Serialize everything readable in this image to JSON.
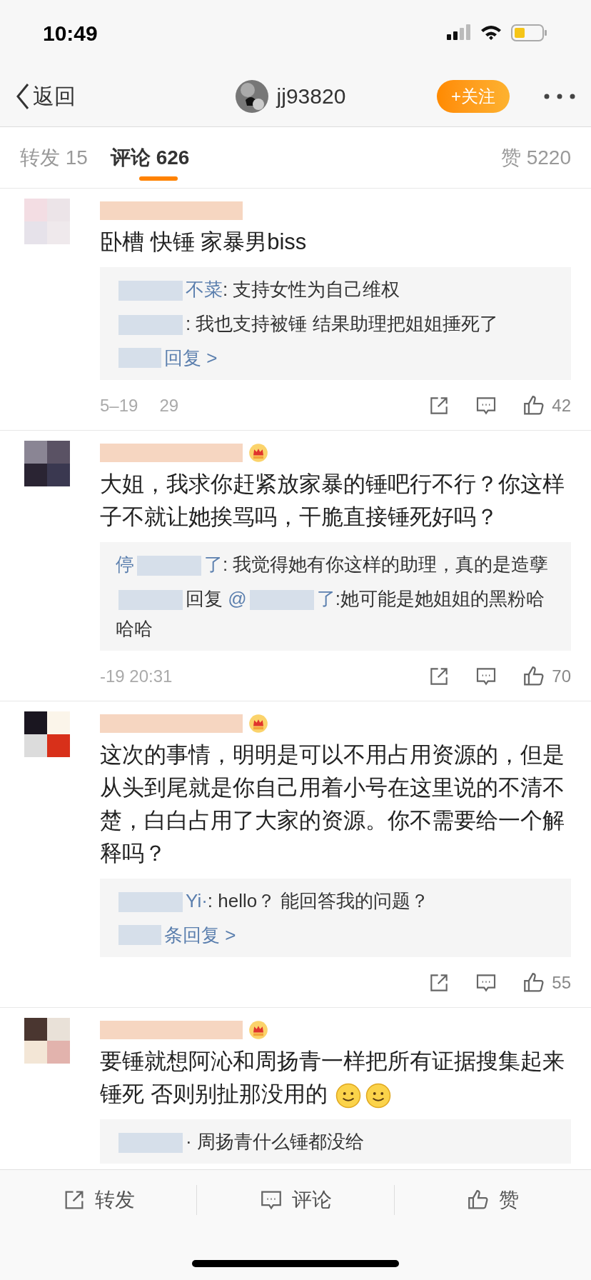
{
  "status_bar": {
    "time": "10:49"
  },
  "nav": {
    "back": "返回",
    "username": "jj93820",
    "follow": "+关注"
  },
  "tabs": [
    {
      "label": "转发 15",
      "selected": false
    },
    {
      "label": "评论 626",
      "selected": true
    },
    {
      "label": "赞 5220",
      "selected": false
    }
  ],
  "comments": [
    {
      "vip": false,
      "body": [
        {
          "kind": "text",
          "text": "卧槽 快锤 家暴男biss"
        }
      ],
      "replies": [
        [
          {
            "kind": "redacted"
          },
          {
            "kind": "name",
            "text": "不菜"
          },
          {
            "kind": "text",
            "text": ": 支持女性为自己维权"
          }
        ],
        [
          {
            "kind": "redacted"
          },
          {
            "kind": "text",
            "text": ": 我也支持被锤 结果助理把姐姐捶死了"
          }
        ]
      ],
      "more": "回复 >",
      "time": [
        "5–19",
        "29"
      ],
      "likes": "42"
    },
    {
      "vip": true,
      "body": [
        {
          "kind": "text",
          "text": "大姐，我求你赶紧放家暴的锤吧行不行？你这样子不就让她挨骂吗，干脆直接锤死好吗？"
        }
      ],
      "replies": [
        [
          {
            "kind": "name",
            "text": "停"
          },
          {
            "kind": "redacted"
          },
          {
            "kind": "name",
            "text": "了"
          },
          {
            "kind": "text",
            "text": ": 我觉得她有你这样的助理，真的是造孽"
          }
        ],
        [
          {
            "kind": "redacted"
          },
          {
            "kind": "text",
            "text": "回复"
          },
          {
            "kind": "name",
            "text": " @"
          },
          {
            "kind": "redacted"
          },
          {
            "kind": "name",
            "text": "了"
          },
          {
            "kind": "text",
            "text": ":她可能是她姐姐的黑粉哈哈哈"
          }
        ]
      ],
      "time": [
        "-19 20:31"
      ],
      "likes": "70"
    },
    {
      "vip": true,
      "body": [
        {
          "kind": "text",
          "text": "这次的事情，明明是可以不用占用资源的，但是从头到尾就是你自己用着小号在这里说的不清不楚，白白占用了大家的资源。你不需要给一个解释吗？"
        }
      ],
      "replies": [
        [
          {
            "kind": "redacted"
          },
          {
            "kind": "name",
            "text": "Yi·"
          },
          {
            "kind": "text",
            "text": ": hello？ 能回答我的问题？"
          }
        ]
      ],
      "more": "条回复 >",
      "likes": "55"
    },
    {
      "vip": true,
      "body": [
        {
          "kind": "text",
          "text": "要锤就想阿沁和周扬青一样把所有证据搜集起来锤死 否则别扯那没用的 "
        },
        {
          "kind": "emoji"
        },
        {
          "kind": "emoji"
        }
      ],
      "replies": [
        [
          {
            "kind": "redacted"
          },
          {
            "kind": "text",
            "text": "· 周扬青什么锤都没给"
          }
        ]
      ]
    }
  ],
  "bottom_bar": [
    {
      "kind": "share",
      "label": "转发"
    },
    {
      "kind": "comment",
      "label": "评论"
    },
    {
      "kind": "like",
      "label": "赞"
    }
  ]
}
